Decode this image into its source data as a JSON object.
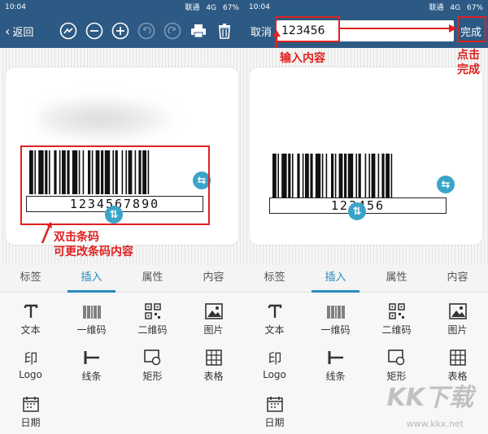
{
  "status": {
    "time": "10:04",
    "carrier": "联通",
    "network": "4G",
    "battery": "67%"
  },
  "left": {
    "back_label": "返回",
    "barcode_number": "1234567890",
    "annotation_line1": "双击条码",
    "annotation_line2": "可更改条码内容"
  },
  "right": {
    "cancel_label": "取消",
    "input_value": "123456",
    "done_label": "完成",
    "barcode_number": "123456",
    "annotation_input": "输入内容",
    "annotation_click1": "点击",
    "annotation_click2": "完成"
  },
  "tabs": [
    "标签",
    "插入",
    "属性",
    "内容"
  ],
  "active_tab": "插入",
  "insert_items": [
    {
      "label": "文本",
      "icon": "text-icon"
    },
    {
      "label": "一维码",
      "icon": "barcode-icon"
    },
    {
      "label": "二维码",
      "icon": "qrcode-icon"
    },
    {
      "label": "图片",
      "icon": "image-icon"
    },
    {
      "label": "Logo",
      "icon": "logo-icon"
    },
    {
      "label": "线条",
      "icon": "line-icon"
    },
    {
      "label": "矩形",
      "icon": "rectangle-icon"
    },
    {
      "label": "表格",
      "icon": "table-icon"
    },
    {
      "label": "日期",
      "icon": "date-icon"
    }
  ],
  "watermark": {
    "logo": "KK下载",
    "url": "www.kkx.net"
  },
  "colors": {
    "toolbar": "#2d5a84",
    "accent": "#2a8ac0",
    "annotation": "#e02020",
    "handle": "#3aa4c8"
  }
}
